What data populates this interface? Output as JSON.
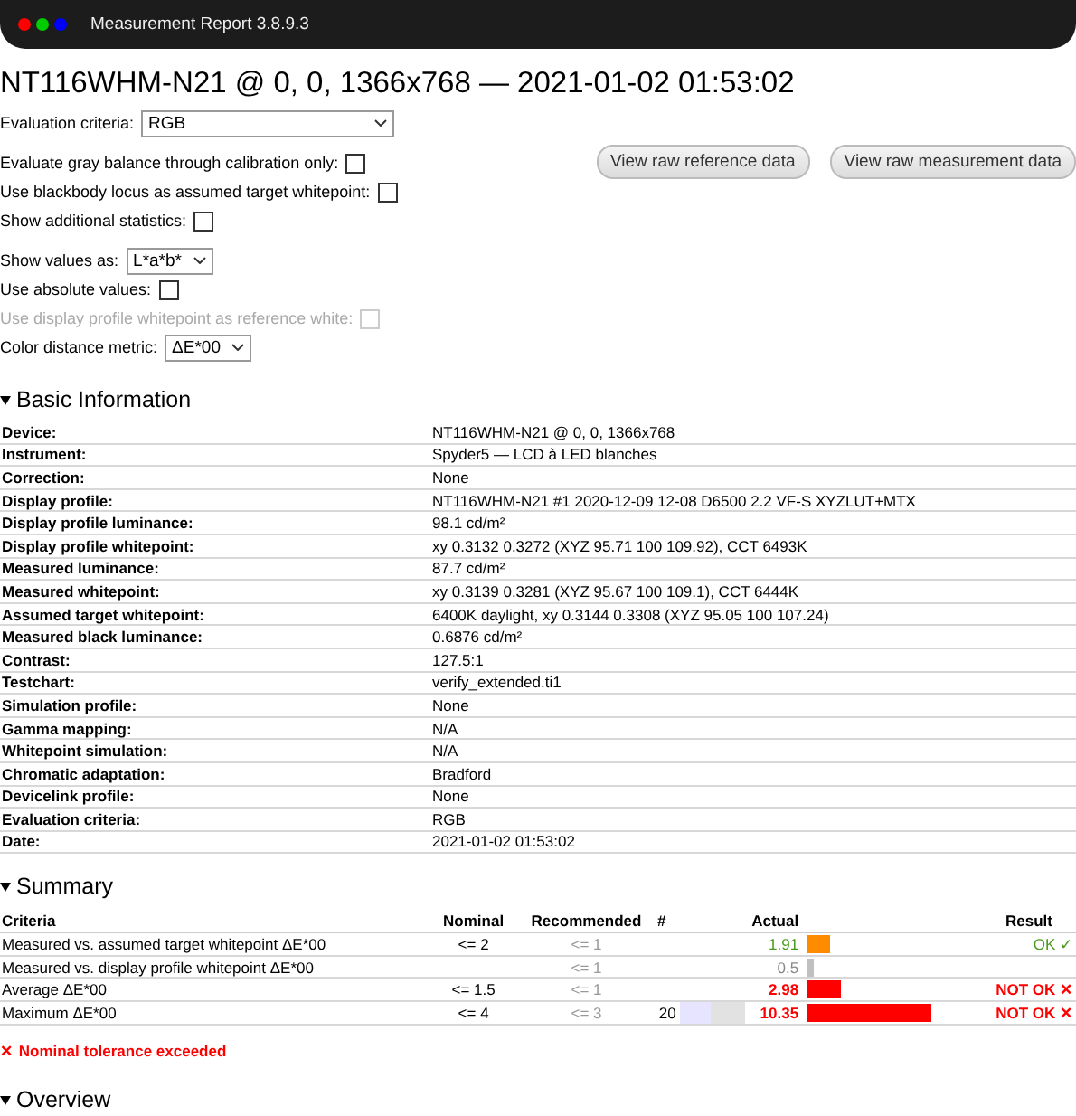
{
  "window": {
    "title": "Measurement Report 3.8.9.3"
  },
  "heading": "NT116WHM-N21 @ 0, 0, 1366x768 — 2021-01-02 01:53:02",
  "buttons": [
    "View raw reference data",
    "View raw measurement data"
  ],
  "options": [
    {
      "kind": "select",
      "label": "Evaluation criteria:",
      "value": "RGB",
      "wide": true
    },
    {
      "kind": "checkbox",
      "label": "Evaluate gray balance through calibration only:",
      "checked": false,
      "disabled": false
    },
    {
      "kind": "checkbox",
      "label": "Use blackbody locus as assumed target whitepoint:",
      "checked": false,
      "disabled": false
    },
    {
      "kind": "checkbox",
      "label": "Show additional statistics:",
      "checked": false,
      "disabled": false
    },
    {
      "kind": "select",
      "label": "Show values as:",
      "value": "L*a*b*",
      "wide": false
    },
    {
      "kind": "checkbox",
      "label": "Use absolute values:",
      "checked": false,
      "disabled": false
    },
    {
      "kind": "checkbox",
      "label": "Use display profile whitepoint as reference white:",
      "checked": false,
      "disabled": true
    },
    {
      "kind": "select",
      "label": "Color distance metric:",
      "value": "ΔE*00",
      "wide": false
    }
  ],
  "basic_information": {
    "title": "Basic Information",
    "expanded": true,
    "rows": [
      [
        "Device:",
        "NT116WHM-N21 @ 0, 0, 1366x768"
      ],
      [
        "Instrument:",
        "Spyder5 — LCD à LED blanches"
      ],
      [
        "Correction:",
        "None"
      ],
      [
        "Display profile:",
        "NT116WHM-N21 #1 2020-12-09 12-08 D6500 2.2 VF-S XYZLUT+MTX"
      ],
      [
        "Display profile luminance:",
        "98.1 cd/m²"
      ],
      [
        "Display profile whitepoint:",
        "xy 0.3132 0.3272 (XYZ 95.71 100 109.92), CCT 6493K"
      ],
      [
        "Measured luminance:",
        "87.7 cd/m²"
      ],
      [
        "Measured whitepoint:",
        "xy 0.3139 0.3281 (XYZ 95.67 100 109.1), CCT 6444K"
      ],
      [
        "Assumed target whitepoint:",
        "6400K daylight, xy 0.3144 0.3308 (XYZ 95.05 100 107.24)"
      ],
      [
        "Measured black luminance:",
        "0.6876 cd/m²"
      ],
      [
        "Contrast:",
        "127.5:1"
      ],
      [
        "Testchart:",
        "verify_extended.ti1"
      ],
      [
        "Simulation profile:",
        "None"
      ],
      [
        "Gamma mapping:",
        "N/A"
      ],
      [
        "Whitepoint simulation:",
        "N/A"
      ],
      [
        "Chromatic adaptation:",
        "Bradford"
      ],
      [
        "Devicelink profile:",
        "None"
      ],
      [
        "Evaluation criteria:",
        "RGB"
      ],
      [
        "Date:",
        "2021-01-02 01:53:02"
      ]
    ]
  },
  "summary": {
    "title": "Summary",
    "expanded": true,
    "columns": [
      "Criteria",
      "Nominal",
      "Recommended",
      "#",
      "Actual",
      "Result"
    ],
    "rows": [
      {
        "criteria": "Measured vs. assumed target whitepoint ΔE*00",
        "nominal": "<= 2",
        "recommended": "<= 1",
        "actual": "1.91",
        "kind": "ok",
        "level": 0.17,
        "color": "#ff8c00",
        "result": "OK ✓"
      },
      {
        "criteria": "Measured vs. display profile whitepoint ΔE*00",
        "recommended": "<= 1",
        "actual": "0.5",
        "kind": "none",
        "level": 0.05,
        "color": "#c0c0c0"
      },
      {
        "criteria": "Average ΔE*00",
        "nominal": "<= 1.5",
        "recommended": "<= 1",
        "actual": "2.98",
        "kind": "fail",
        "level": 0.24,
        "color": "#ff0000",
        "result": "NOT OK ✕"
      },
      {
        "criteria": "Maximum ΔE*00",
        "nominal": "<= 4",
        "recommended": "<= 3",
        "count": "20",
        "swatch": true,
        "actual": "10.35",
        "kind": "fail",
        "level": 0.88,
        "color": "#ff0000",
        "result": "NOT OK ✕"
      }
    ],
    "note": "✕ Nominal tolerance exceeded"
  },
  "overview": {
    "title": "Overview",
    "expanded": true
  }
}
